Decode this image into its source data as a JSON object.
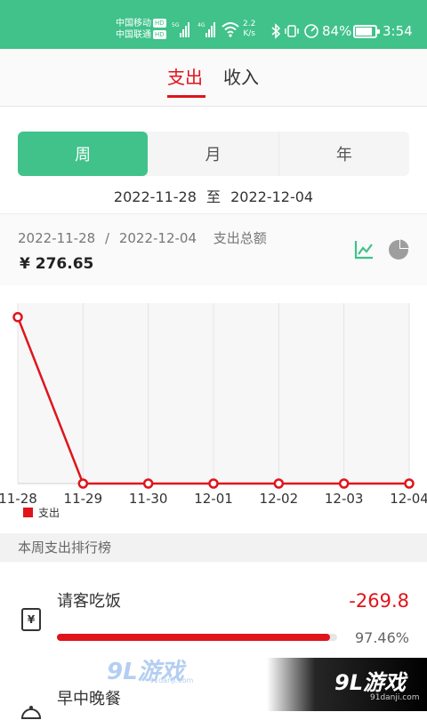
{
  "status_bar": {
    "carrier1": "中国移动",
    "carrier2": "中国联通",
    "hd": "HD",
    "net1": "5G",
    "net2": "4G",
    "speed_value": "2.2",
    "speed_unit": "K/s",
    "battery": "84%",
    "battery_level": 0.84,
    "time": "3:54"
  },
  "tabs": [
    {
      "label": "支出",
      "active": true
    },
    {
      "label": "收入",
      "active": false
    }
  ],
  "period": {
    "options": [
      "周",
      "月",
      "年"
    ],
    "selected": "周"
  },
  "range": {
    "start": "2022-11-28",
    "sep": "至",
    "end": "2022-12-04"
  },
  "summary": {
    "start": "2022-11-28",
    "slash": "/",
    "end": "2022-12-04",
    "label": "支出总额",
    "amount": "¥ 276.65"
  },
  "colors": {
    "accent": "#40c28a",
    "expense": "#e0141b"
  },
  "chart_data": {
    "type": "line",
    "categories": [
      "11-28",
      "11-29",
      "11-30",
      "12-01",
      "12-02",
      "12-03",
      "12-04"
    ],
    "series": [
      {
        "name": "支出",
        "values": [
          276.65,
          0,
          0,
          0,
          0,
          0,
          0
        ]
      }
    ],
    "ylim": [
      0,
      300
    ],
    "grid": true,
    "legend": "bottom-left"
  },
  "ranking": {
    "title": "本周支出排行榜",
    "items": [
      {
        "name": "请客吃饭",
        "amount": "-269.8",
        "percent": "97.46%",
        "ratio": 0.9746,
        "icon": "yen-book-icon"
      },
      {
        "name": "早中晚餐",
        "amount": "",
        "percent": "",
        "ratio": 0,
        "icon": "meal-icon"
      }
    ]
  },
  "watermark": {
    "left_brand": "9L游戏",
    "left_url": "91danji.com",
    "right_brand": "9L游戏",
    "right_url": "91danji.com"
  }
}
